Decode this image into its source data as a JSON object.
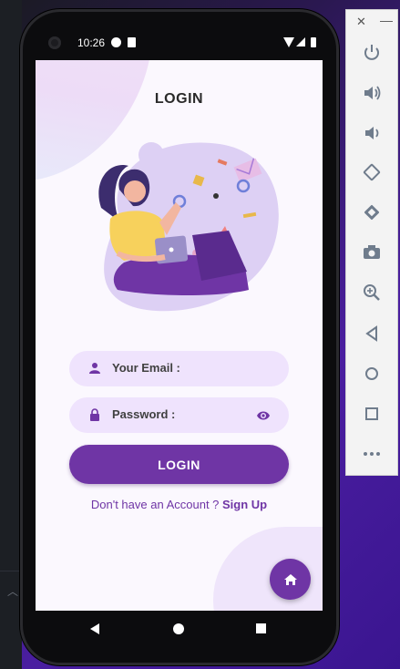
{
  "status_bar": {
    "time": "10:26"
  },
  "screen": {
    "title": "LOGIN",
    "email_field": {
      "placeholder": "Your Email :"
    },
    "password_field": {
      "placeholder": "Password :"
    },
    "login_button": "LOGIN",
    "signup_prompt": "Don't have an Account ? ",
    "signup_link": "Sign Up"
  },
  "colors": {
    "primary": "#6f35a5",
    "field_bg": "#efe3fd",
    "screen_bg": "#fbf8fe"
  },
  "emulator_toolbar": {
    "window_controls": [
      "close-icon",
      "minimize-icon"
    ],
    "buttons": [
      "power-icon",
      "volume-up-icon",
      "volume-down-icon",
      "rotate-left-icon",
      "rotate-right-icon",
      "camera-icon",
      "zoom-icon",
      "back-icon",
      "home-icon",
      "overview-icon",
      "more-icon"
    ]
  }
}
